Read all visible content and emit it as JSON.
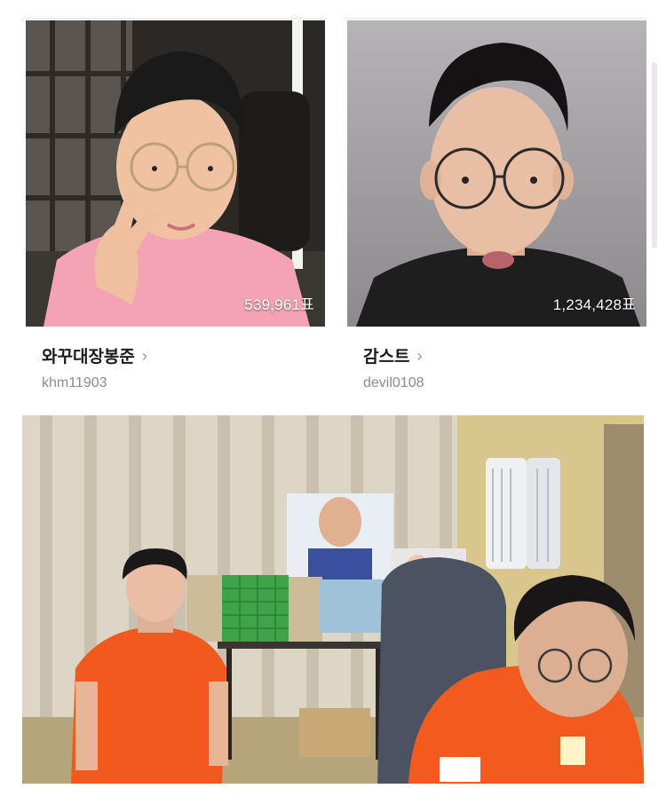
{
  "cards": [
    {
      "name": "와꾸대장봉준",
      "handle": "khm11903",
      "votes": "539,961표",
      "chevron": "›"
    },
    {
      "name": "감스트",
      "handle": "devil0108",
      "votes": "1,234,428표",
      "chevron": "›"
    }
  ],
  "icons": {
    "chevron": "chevron-right-icon"
  },
  "colors": {
    "text_primary": "#1a1a1a",
    "text_secondary": "#8c8c8c",
    "jersey_orange": "#f25a1e",
    "shirt_pink": "#f3a3b3"
  }
}
